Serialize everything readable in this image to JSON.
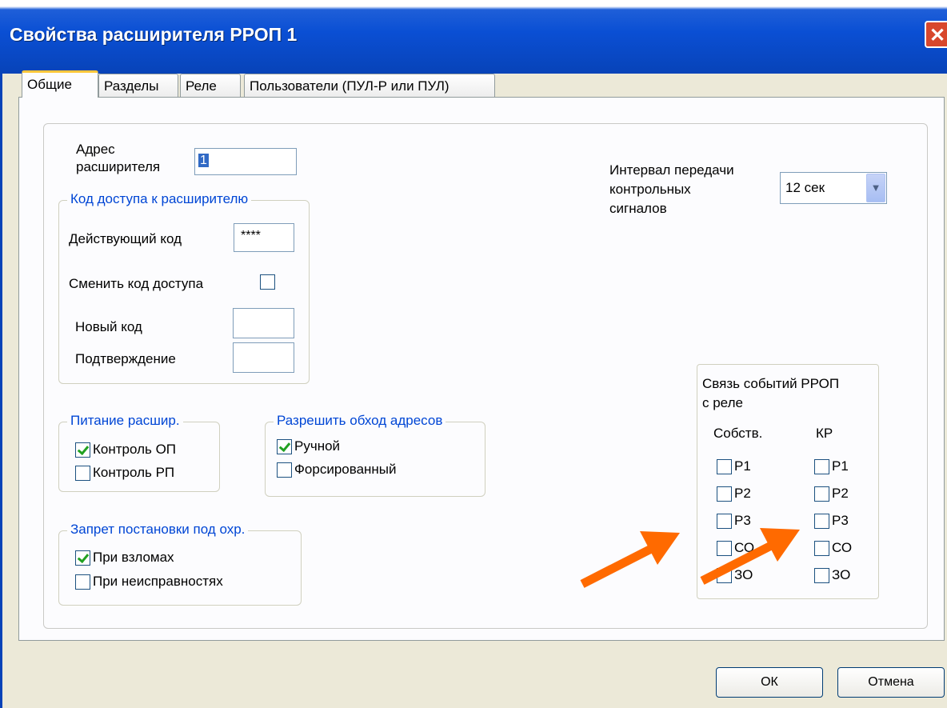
{
  "window": {
    "title": "Свойства расширителя РРОП 1",
    "close_glyph": "✕"
  },
  "tabs": [
    {
      "label": "Общие"
    },
    {
      "label": "Разделы"
    },
    {
      "label": "Реле"
    },
    {
      "label": "Пользователи (ПУЛ-Р или ПУЛ)"
    }
  ],
  "address": {
    "label_line1": "Адрес",
    "label_line2": "расширителя",
    "value": "1"
  },
  "access_code": {
    "title": "Код доступа к расширителю",
    "current_label": "Действующий код",
    "current_value": "****",
    "change_label": "Сменить код доступа",
    "new_label": "Новый код",
    "confirm_label": "Подтверждение"
  },
  "interval": {
    "label_line1": "Интервал передачи",
    "label_line2": "контрольных",
    "label_line3": "сигналов",
    "value": "12 сек"
  },
  "power": {
    "title": "Питание расшир.",
    "items": [
      {
        "label": "Контроль ОП",
        "checked": true
      },
      {
        "label": "Контроль РП",
        "checked": false
      }
    ]
  },
  "bypass": {
    "title": "Разрешить обход адресов",
    "items": [
      {
        "label": "Ручной",
        "checked": true
      },
      {
        "label": "Форсированный",
        "checked": false
      }
    ]
  },
  "arming_ban": {
    "title": "Запрет постановки под охр.",
    "items": [
      {
        "label": "При взломах",
        "checked": true
      },
      {
        "label": "При неисправностях",
        "checked": false
      }
    ]
  },
  "relay_link": {
    "title_line1": "Связь событий РРОП",
    "title_line2": "с реле",
    "col_own": "Собств.",
    "col_kr": "КР",
    "own": [
      "Р1",
      "Р2",
      "Р3",
      "СО",
      "ЗО"
    ],
    "kr": [
      "Р1",
      "Р2",
      "Р3",
      "СО",
      "ЗО"
    ]
  },
  "buttons": {
    "ok": "ОК",
    "cancel": "Отмена"
  },
  "colors": {
    "accent_arrow": "#ff6a00",
    "title_bar": "#0a4fd4",
    "group_title": "#0046d5"
  }
}
